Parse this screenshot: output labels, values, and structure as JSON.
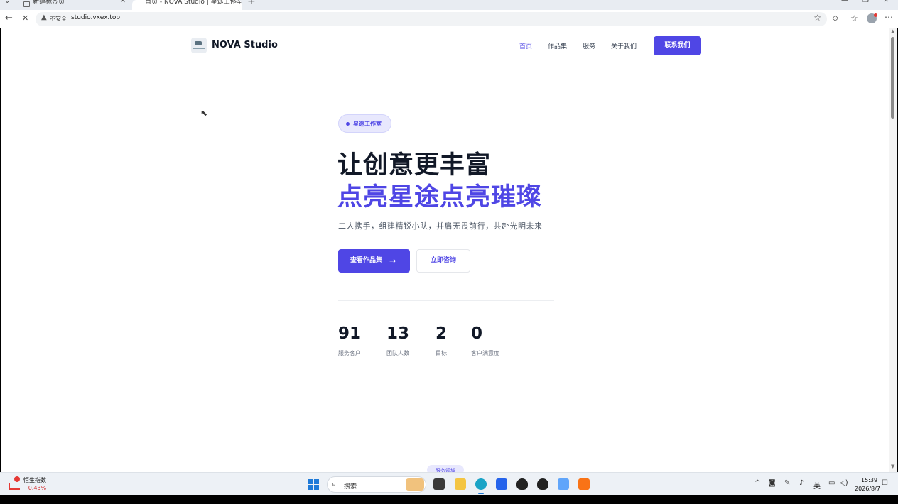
{
  "browser": {
    "tabs": [
      {
        "title": "新建标签页"
      },
      {
        "title": "首页 - NOVA Studio | 星途工作室"
      }
    ],
    "new_tab_label": "+",
    "back_icon": "←",
    "reload_icon": "✕",
    "insecure_label": "不安全",
    "url": "studio.vxex.top"
  },
  "site": {
    "brand": "NOVA Studio",
    "nav": [
      {
        "label": "首页",
        "active": true
      },
      {
        "label": "作品集",
        "active": false
      },
      {
        "label": "服务",
        "active": false
      },
      {
        "label": "关于我们",
        "active": false
      }
    ],
    "contact_button": "联系我们",
    "badge": "星途工作室",
    "hero_title_line1": "让创意更丰富",
    "hero_title_line2": "点亮星途点亮璀璨",
    "hero_subtitle": "二人携手，组建精锐小队，并肩无畏前行，共赴光明未来",
    "primary_button": "查看作品集",
    "secondary_button": "立即咨询",
    "stats": [
      {
        "value": "91",
        "label": "服务客户"
      },
      {
        "value": "13",
        "label": "团队人数"
      },
      {
        "value": "2",
        "label": "目标"
      },
      {
        "value": "0",
        "label": "客户满意度"
      }
    ],
    "next_section_badge": "服务领域",
    "accent_color": "#4f46e5"
  },
  "taskbar": {
    "stock_name": "恒生指数",
    "stock_change": "+0.43%",
    "search_label": "搜索",
    "ime_label": "英",
    "time": "15:39",
    "date": "2026/8/7"
  }
}
